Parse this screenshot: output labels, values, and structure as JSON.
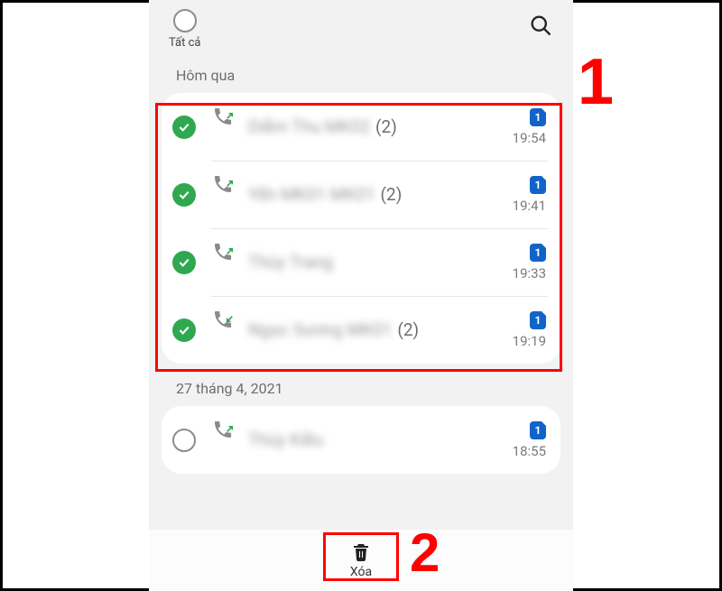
{
  "header": {
    "select_all_label": "Tất cả"
  },
  "sections": {
    "yesterday_label": "Hôm qua",
    "date2_label": "27 tháng 4, 2021"
  },
  "calls_yesterday": [
    {
      "name": "Diễm Thu MK02",
      "count": "(2)",
      "time": "19:54",
      "sim": "1",
      "dir": "out"
    },
    {
      "name": "Yến MK01 MK01",
      "count": "(2)",
      "time": "19:41",
      "sim": "1",
      "dir": "out"
    },
    {
      "name": "Thùy Trang",
      "count": "",
      "time": "19:33",
      "sim": "1",
      "dir": "out"
    },
    {
      "name": "Ngọc Sương MK01",
      "count": "(2)",
      "time": "19:19",
      "sim": "1",
      "dir": "in"
    }
  ],
  "calls_date2": [
    {
      "name": "Thúy Kiều",
      "count": "",
      "time": "18:55",
      "sim": "1",
      "dir": "out"
    }
  ],
  "bottom": {
    "delete_label": "Xóa"
  },
  "annotations": {
    "step1": "1",
    "step2": "2"
  }
}
